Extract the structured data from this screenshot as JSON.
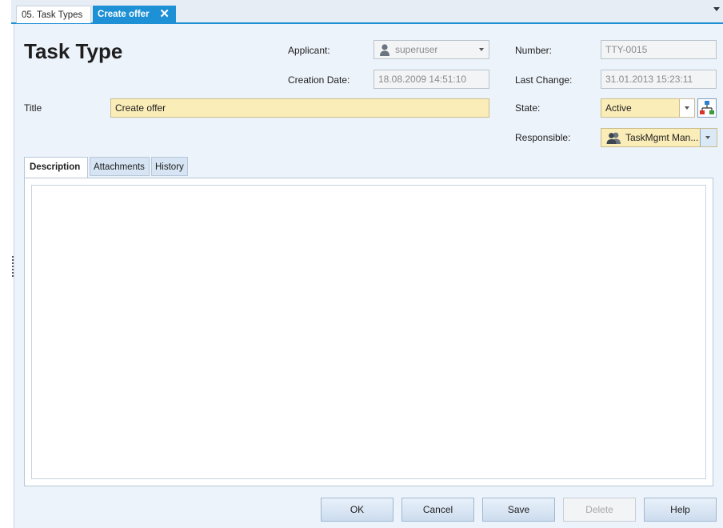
{
  "tabs": [
    {
      "label": "05. Task Types"
    },
    {
      "label": "Create offer"
    }
  ],
  "icons": {
    "close": "close-icon",
    "strip_menu": "chevron-down-icon",
    "user": "user-icon",
    "group": "group-icon",
    "hierarchy": "hierarchy-icon"
  },
  "header": {
    "title": "Task Type"
  },
  "form": {
    "applicant_label": "Applicant:",
    "applicant_value": "superuser",
    "creation_date_label": "Creation Date:",
    "creation_date_value": "18.08.2009 14:51:10",
    "number_label": "Number:",
    "number_value": "TTY-0015",
    "last_change_label": "Last Change:",
    "last_change_value": "31.01.2013 15:23:11",
    "title_label": "Title",
    "title_value": "Create offer",
    "state_label": "State:",
    "state_value": "Active",
    "responsible_label": "Responsible:",
    "responsible_value": "TaskMgmt Man..."
  },
  "inner_tabs": [
    {
      "label": "Description"
    },
    {
      "label": "Attachments"
    },
    {
      "label": "History"
    }
  ],
  "buttons": {
    "ok": "OK",
    "cancel": "Cancel",
    "save": "Save",
    "delete": "Delete",
    "help": "Help"
  },
  "colors": {
    "accent": "#1d90d6",
    "editable_field": "#fbedb8",
    "panel_bg": "#edf3fb"
  }
}
